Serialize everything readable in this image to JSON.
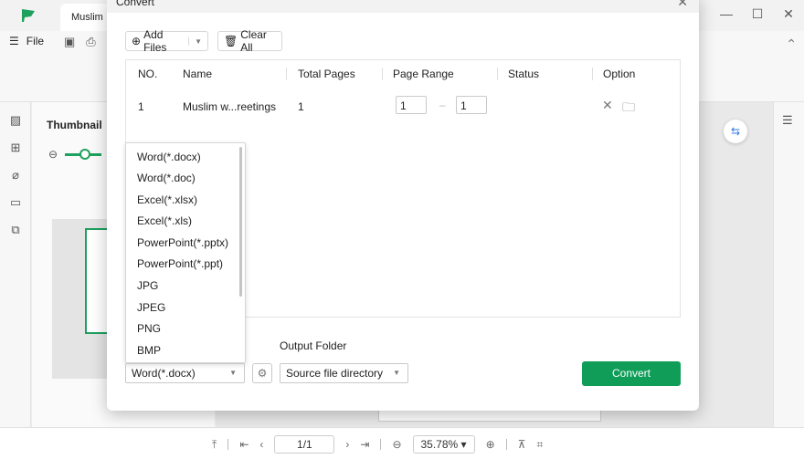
{
  "app": {
    "doc_tab": "Muslim",
    "menu_file": "File",
    "thumbnail_title": "Thumbnail"
  },
  "statusbar": {
    "page": "1/1",
    "zoom": "35.78%"
  },
  "dialog": {
    "title": "Convert",
    "add_files": "Add Files",
    "clear_all": "Clear All",
    "columns": [
      "NO.",
      "Name",
      "Total Pages",
      "Page Range",
      "Status",
      "Option"
    ],
    "rows": [
      {
        "no": "1",
        "name": "Muslim w...reetings",
        "total_pages": "1",
        "range_from": "1",
        "range_to": "1",
        "status": ""
      }
    ],
    "format_options": [
      "Word(*.docx)",
      "Word(*.doc)",
      "Excel(*.xlsx)",
      "Excel(*.xls)",
      "PowerPoint(*.pptx)",
      "PowerPoint(*.ppt)",
      "JPG",
      "JPEG",
      "PNG",
      "BMP"
    ],
    "selected_format": "Word(*.docx)",
    "output_folder_label": "Output Folder",
    "output_folder_value": "Source file directory",
    "convert_label": "Convert"
  },
  "colors": {
    "accent": "#0f9d58"
  }
}
